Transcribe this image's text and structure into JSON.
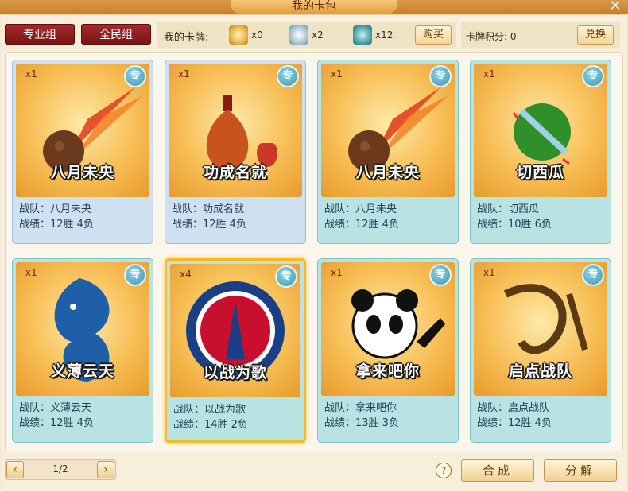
{
  "window": {
    "title": "我的卡包",
    "close_icon": "close-icon"
  },
  "tabs": [
    {
      "label": "专业组"
    },
    {
      "label": "全民组"
    }
  ],
  "my_cards": {
    "label": "我的卡牌:",
    "items": [
      {
        "icon": "gold-card-icon",
        "count": "x0",
        "color": "#e8b84a"
      },
      {
        "icon": "silver-card-icon",
        "count": "x2",
        "color": "#a9c7d6"
      },
      {
        "icon": "teal-card-icon",
        "count": "x12",
        "color": "#4fa3a8"
      }
    ],
    "buy_label": "购买"
  },
  "points": {
    "label": "卡牌积分: 0",
    "exchange_label": "兑换"
  },
  "cards": [
    {
      "qty": "x1",
      "badge": "专",
      "logo_text": "八月未央",
      "team": "战队：八月未央",
      "record": "战绩：12胜 4负",
      "style": "blue",
      "art": "meteor"
    },
    {
      "qty": "x1",
      "badge": "专",
      "logo_text": "功成名就",
      "team": "战队：功成名就",
      "record": "战绩：12胜 4负",
      "style": "blue",
      "art": "bottle"
    },
    {
      "qty": "x1",
      "badge": "专",
      "logo_text": "八月未央",
      "team": "战队：八月未央",
      "record": "战绩：12胜 4负",
      "style": "teal",
      "art": "meteor"
    },
    {
      "qty": "x1",
      "badge": "专",
      "logo_text": "切西瓜",
      "team": "战队：切西瓜",
      "record": "战绩：10胜 6负",
      "style": "teal",
      "art": "melon"
    },
    {
      "qty": "x1",
      "badge": "专",
      "logo_text": "义薄云天",
      "team": "战队：义薄云天",
      "record": "战绩：12胜 4负",
      "style": "teal",
      "art": "dragon"
    },
    {
      "qty": "x4",
      "badge": "专",
      "logo_text": "以战为歌",
      "team": "战队：以战为歌",
      "record": "战绩：14胜 2负",
      "style": "teal",
      "art": "psg",
      "selected": true
    },
    {
      "qty": "x1",
      "badge": "专",
      "logo_text": "拿来吧你",
      "team": "战队：拿来吧你",
      "record": "战绩：13胜 3负",
      "style": "teal",
      "art": "panda"
    },
    {
      "qty": "x1",
      "badge": "专",
      "logo_text": "启点战队",
      "team": "战队：启点战队",
      "record": "战绩：12胜 4负",
      "style": "teal",
      "art": "qidian"
    }
  ],
  "footer": {
    "page": "1/2",
    "prev_icon": "chevron-left-icon",
    "next_icon": "chevron-right-icon",
    "help": "?",
    "compose_label": "合成",
    "decompose_label": "分解"
  }
}
